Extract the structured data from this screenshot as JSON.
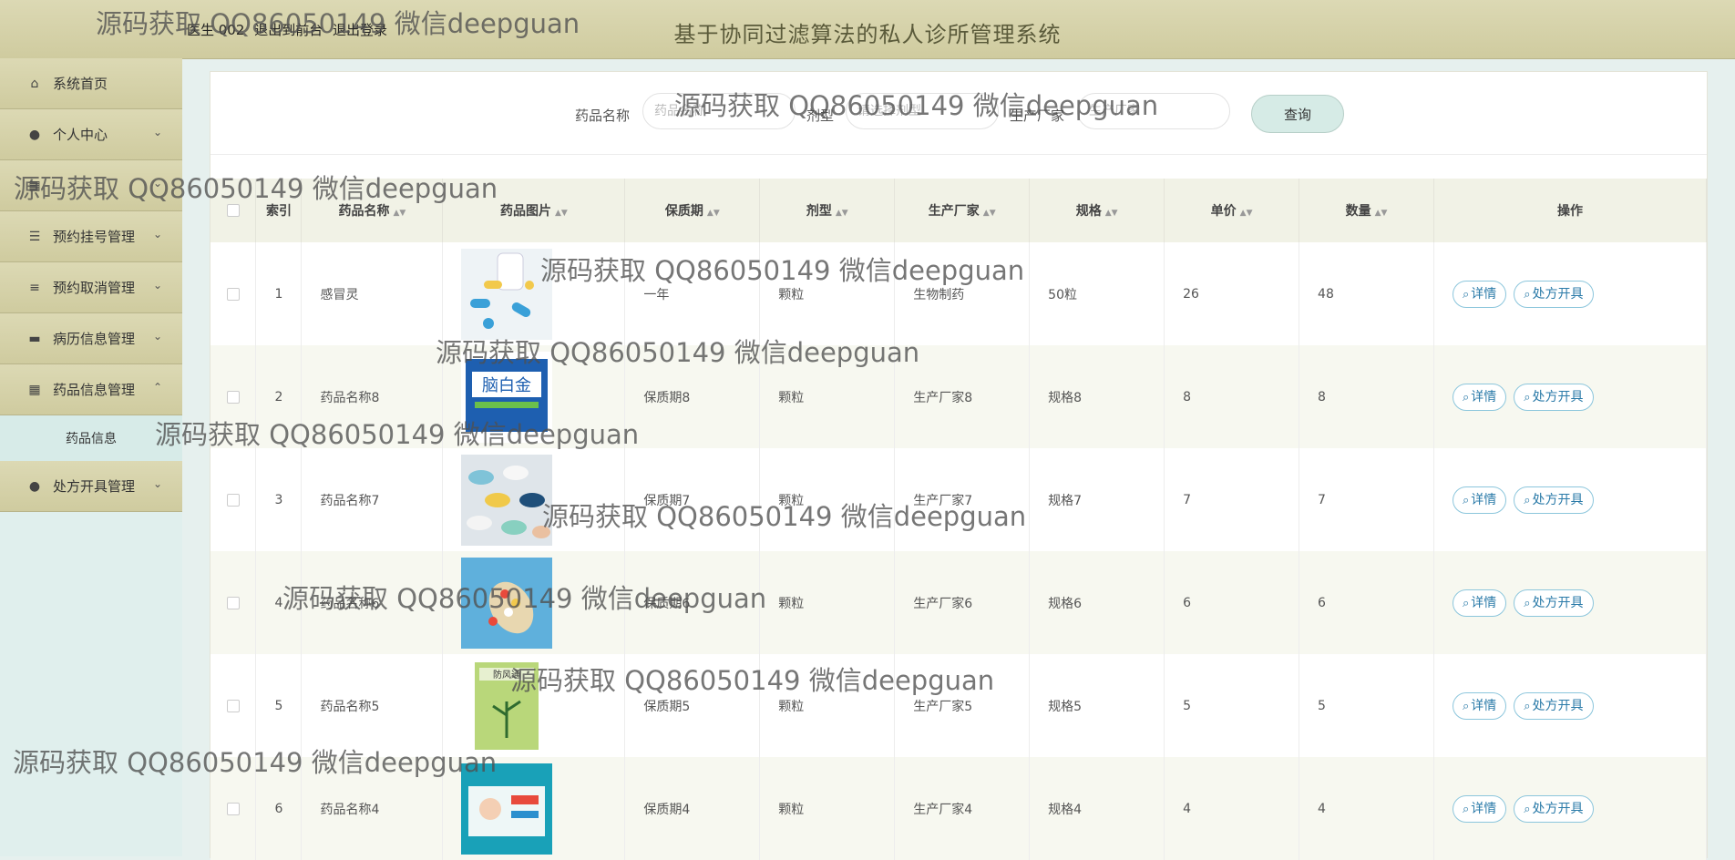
{
  "header": {
    "user_label": "医生 002",
    "back_link": "退出到前台",
    "logout_link": "退出登录",
    "title": "基于协同过滤算法的私人诊所管理系统"
  },
  "sidebar": {
    "items": [
      {
        "label": "系统首页",
        "icon": "home-icon"
      },
      {
        "label": "个人中心",
        "icon": "user-icon"
      },
      {
        "label": "",
        "icon": "grid-icon"
      },
      {
        "label": "预约挂号管理",
        "icon": "sliders-icon"
      },
      {
        "label": "预约取消管理",
        "icon": "list-icon"
      },
      {
        "label": "病历信息管理",
        "icon": "briefcase-icon"
      },
      {
        "label": "药品信息管理",
        "icon": "grid-icon"
      },
      {
        "label": "处方开具管理",
        "icon": "user-icon"
      }
    ],
    "submenu": "药品信息"
  },
  "search": {
    "name_label": "药品名称",
    "name_placeholder": "药品名称",
    "type_label": "剂型",
    "type_placeholder": "请选择剂型",
    "maker_label": "生产厂家",
    "maker_placeholder": "生产厂家",
    "button": "查询"
  },
  "table": {
    "headers": [
      "索引",
      "药品名称",
      "药品图片",
      "保质期",
      "剂型",
      "生产厂家",
      "规格",
      "单价",
      "数量",
      "操作"
    ],
    "rows": [
      {
        "idx": "1",
        "name": "感冒灵",
        "shelf": "一年",
        "type": "颗粒",
        "maker": "生物制药",
        "spec": "50粒",
        "price": "26",
        "qty": "48",
        "img": "pills-white-blue"
      },
      {
        "idx": "2",
        "name": "药品名称8",
        "shelf": "保质期8",
        "type": "颗粒",
        "maker": "生产厂家8",
        "spec": "规格8",
        "price": "8",
        "qty": "8",
        "img": "box-blue-naobaijin"
      },
      {
        "idx": "3",
        "name": "药品名称7",
        "shelf": "保质期7",
        "type": "颗粒",
        "maker": "生产厂家7",
        "spec": "规格7",
        "price": "7",
        "qty": "7",
        "img": "pills-pastel"
      },
      {
        "idx": "4",
        "name": "药品名称6",
        "shelf": "保质期6",
        "type": "颗粒",
        "maker": "生产厂家6",
        "spec": "规格6",
        "price": "6",
        "qty": "6",
        "img": "pills-spoon-blue"
      },
      {
        "idx": "5",
        "name": "药品名称5",
        "shelf": "保质期5",
        "type": "颗粒",
        "maker": "生产厂家5",
        "spec": "规格5",
        "price": "5",
        "qty": "5",
        "img": "box-green-fangfeng"
      },
      {
        "idx": "6",
        "name": "药品名称4",
        "shelf": "保质期4",
        "type": "颗粒",
        "maker": "生产厂家4",
        "spec": "规格4",
        "price": "4",
        "qty": "4",
        "img": "box-teal-kids"
      }
    ],
    "detail_btn": "详情",
    "prescribe_btn": "处方开具"
  },
  "watermark": "源码获取 QQ86050149 微信deepguan",
  "colors": {
    "header_bg": "#d6d3aa",
    "sidebar_bg": "#e0efed",
    "accent": "#2a7aa8"
  }
}
